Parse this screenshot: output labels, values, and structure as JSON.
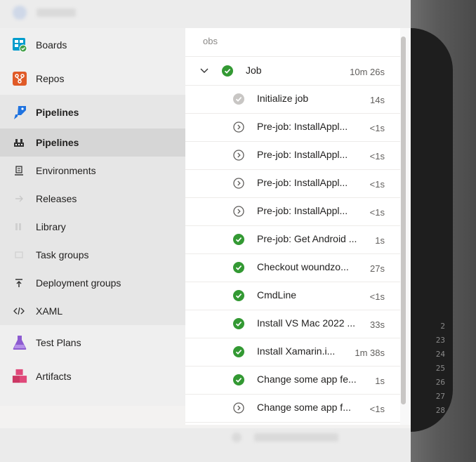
{
  "sidebar": {
    "items": [
      {
        "label": "Boards",
        "icon": "boards-icon",
        "color": "#009ccc"
      },
      {
        "label": "Repos",
        "icon": "repos-icon",
        "color": "#e05a27"
      },
      {
        "label": "Pipelines",
        "icon": "pipelines-icon",
        "color": "#1f73e0"
      }
    ],
    "subitems": [
      {
        "label": "Pipelines",
        "icon": "pipeline-icon"
      },
      {
        "label": "Environments",
        "icon": "environments-icon"
      },
      {
        "label": "Releases",
        "icon": "releases-icon"
      },
      {
        "label": "Library",
        "icon": "library-icon"
      },
      {
        "label": "Task groups",
        "icon": "task-groups-icon"
      },
      {
        "label": "Deployment groups",
        "icon": "deployment-groups-icon"
      },
      {
        "label": "XAML",
        "icon": "xaml-icon"
      }
    ],
    "bottom_items": [
      {
        "label": "Test Plans",
        "icon": "test-plans-icon",
        "color": "#8d5bd1"
      },
      {
        "label": "Artifacts",
        "icon": "artifacts-icon",
        "color": "#cc3864"
      }
    ]
  },
  "jobs": {
    "header": "obs",
    "job": {
      "name": "Job",
      "duration": "10m 26s",
      "status": "success"
    },
    "steps": [
      {
        "name": "Initialize job",
        "duration": "14s",
        "status": "skipped"
      },
      {
        "name": "Pre-job: InstallAppl...",
        "duration": "<1s",
        "status": "pending"
      },
      {
        "name": "Pre-job: InstallAppl...",
        "duration": "<1s",
        "status": "pending"
      },
      {
        "name": "Pre-job: InstallAppl...",
        "duration": "<1s",
        "status": "pending"
      },
      {
        "name": "Pre-job: InstallAppl...",
        "duration": "<1s",
        "status": "pending"
      },
      {
        "name": "Pre-job: Get Android ...",
        "duration": "1s",
        "status": "success"
      },
      {
        "name": "Checkout woundzo...",
        "duration": "27s",
        "status": "success"
      },
      {
        "name": "CmdLine",
        "duration": "<1s",
        "status": "success"
      },
      {
        "name": "Install VS Mac 2022 ...",
        "duration": "33s",
        "status": "success"
      },
      {
        "name": "Install Xamarin.i...",
        "duration": "1m 38s",
        "status": "success"
      },
      {
        "name": "Change some app fe...",
        "duration": "1s",
        "status": "success"
      },
      {
        "name": "Change some app f...",
        "duration": "<1s",
        "status": "pending"
      }
    ]
  },
  "log_line_numbers": [
    "2",
    "23",
    "24",
    "25",
    "26",
    "27",
    "28"
  ],
  "colors": {
    "success": "#339933",
    "skipped": "#c8c6c4",
    "pending": "#605e5c"
  }
}
